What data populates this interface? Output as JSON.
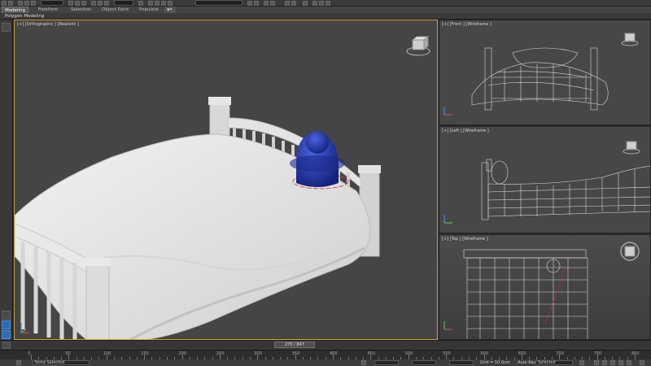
{
  "ribbon": {
    "tabs": [
      "Modeling",
      "Freeform",
      "Selection",
      "Object Paint",
      "Populate"
    ],
    "active_tab": "Modeling",
    "panel_label": "Polygon Modeling"
  },
  "viewports": {
    "perspective": {
      "label": "[+] [Orthographic ] [Realistic ]"
    },
    "front": {
      "label": "[+] [Front ] [Wireframe ]"
    },
    "left": {
      "label": "[+] [Left ] [Wireframe ]"
    },
    "top": {
      "label": "[+] [Top ] [Wireframe ]"
    }
  },
  "timeline": {
    "frame_readout": "270 / 847",
    "ticks": [
      "0",
      "50",
      "100",
      "150",
      "200",
      "250",
      "300",
      "350",
      "400",
      "450",
      "500",
      "550",
      "600",
      "650",
      "700",
      "750",
      "800"
    ]
  },
  "status": {
    "selection": "None Selected",
    "grid": "Grid = 10.0cm",
    "auto_key": "Auto Key",
    "key_filter": "Selected"
  },
  "colors": {
    "active_viewport_border": "#c9a23a",
    "object_blue": "#1f2f9a",
    "viewport_bg": "#474747"
  }
}
